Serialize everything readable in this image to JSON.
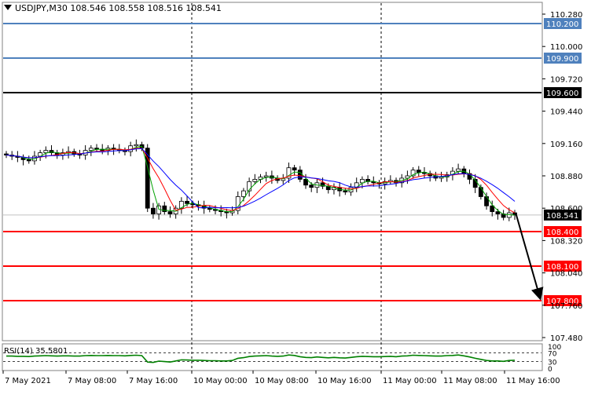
{
  "header": {
    "symbol": "USDJPY,M30",
    "open": "108.546",
    "high": "108.558",
    "low": "108.516",
    "close": "108.541"
  },
  "rsi": {
    "label": "RSI(14) 35.5801",
    "levels": [
      "100",
      "70",
      "30",
      "0"
    ]
  },
  "price_axis": {
    "ticks": [
      "110.280",
      "110.000",
      "109.720",
      "109.440",
      "109.160",
      "108.880",
      "108.600",
      "108.320",
      "108.040",
      "107.760",
      "107.480"
    ],
    "current_price": "108.541"
  },
  "level_lines": [
    {
      "label": "110.200",
      "color": "#4f81bd"
    },
    {
      "label": "109.900",
      "color": "#4f81bd"
    },
    {
      "label": "109.600",
      "color": "#000000"
    },
    {
      "label": "108.400",
      "color": "#ff0000"
    },
    {
      "label": "108.100",
      "color": "#ff0000"
    },
    {
      "label": "107.800",
      "color": "#ff0000"
    }
  ],
  "time_axis": [
    "7 May 2021",
    "7 May 08:00",
    "7 May 16:00",
    "10 May 00:00",
    "10 May 08:00",
    "10 May 16:00",
    "11 May 00:00",
    "11 May 08:00",
    "11 May 16:00"
  ],
  "colors": {
    "bull": "#ffffff",
    "bear": "#000000",
    "ma_fast": "#00a000",
    "ma_mid": "#ff0000",
    "ma_slow": "#0000ff",
    "rsi_line": "#008000"
  },
  "chart_data": {
    "type": "candlestick",
    "title": "USDJPY,M30",
    "ylim": [
      107.42,
      110.33
    ],
    "x": [
      "7 May 2021",
      "7 May 08:00",
      "7 May 16:00",
      "10 May 00:00",
      "10 May 08:00",
      "10 May 16:00",
      "11 May 00:00",
      "11 May 08:00",
      "11 May 16:00"
    ],
    "close_path": [
      109.06,
      109.05,
      109.04,
      109.02,
      109.01,
      109.05,
      109.08,
      109.1,
      109.08,
      109.06,
      109.08,
      109.09,
      109.07,
      109.06,
      109.1,
      109.12,
      109.11,
      109.1,
      109.12,
      109.11,
      109.1,
      109.09,
      109.14,
      109.15,
      109.12,
      108.6,
      108.55,
      108.62,
      108.57,
      108.55,
      108.6,
      108.66,
      108.64,
      108.63,
      108.62,
      108.6,
      108.59,
      108.58,
      108.57,
      108.56,
      108.58,
      108.7,
      108.75,
      108.83,
      108.85,
      108.87,
      108.88,
      108.86,
      108.84,
      108.86,
      108.95,
      108.93,
      108.85,
      108.8,
      108.78,
      108.82,
      108.79,
      108.76,
      108.78,
      108.75,
      108.74,
      108.78,
      108.82,
      108.85,
      108.83,
      108.82,
      108.81,
      108.83,
      108.84,
      108.82,
      108.86,
      108.88,
      108.93,
      108.91,
      108.9,
      108.88,
      108.86,
      108.87,
      108.89,
      108.92,
      108.94,
      108.9,
      108.85,
      108.78,
      108.7,
      108.62,
      108.57,
      108.55,
      108.52,
      108.56,
      108.54
    ],
    "rsi": [
      55,
      55,
      54,
      54,
      53,
      55,
      56,
      57,
      56,
      55,
      56,
      56,
      55,
      55,
      57,
      58,
      57,
      57,
      58,
      57,
      57,
      56,
      58,
      59,
      57,
      28,
      26,
      32,
      30,
      28,
      33,
      38,
      37,
      36,
      36,
      35,
      34,
      34,
      33,
      33,
      35,
      45,
      48,
      53,
      55,
      56,
      57,
      55,
      54,
      55,
      60,
      58,
      52,
      49,
      48,
      51,
      49,
      47,
      49,
      47,
      46,
      49,
      52,
      54,
      53,
      52,
      52,
      53,
      54,
      52,
      55,
      56,
      59,
      58,
      57,
      56,
      55,
      55,
      57,
      58,
      60,
      56,
      51,
      45,
      40,
      35,
      33,
      33,
      31,
      35,
      36
    ],
    "levels": [
      110.2,
      109.9,
      109.6,
      108.4,
      108.1,
      107.8
    ],
    "forecast": {
      "from": 108.54,
      "to": 107.8
    }
  }
}
